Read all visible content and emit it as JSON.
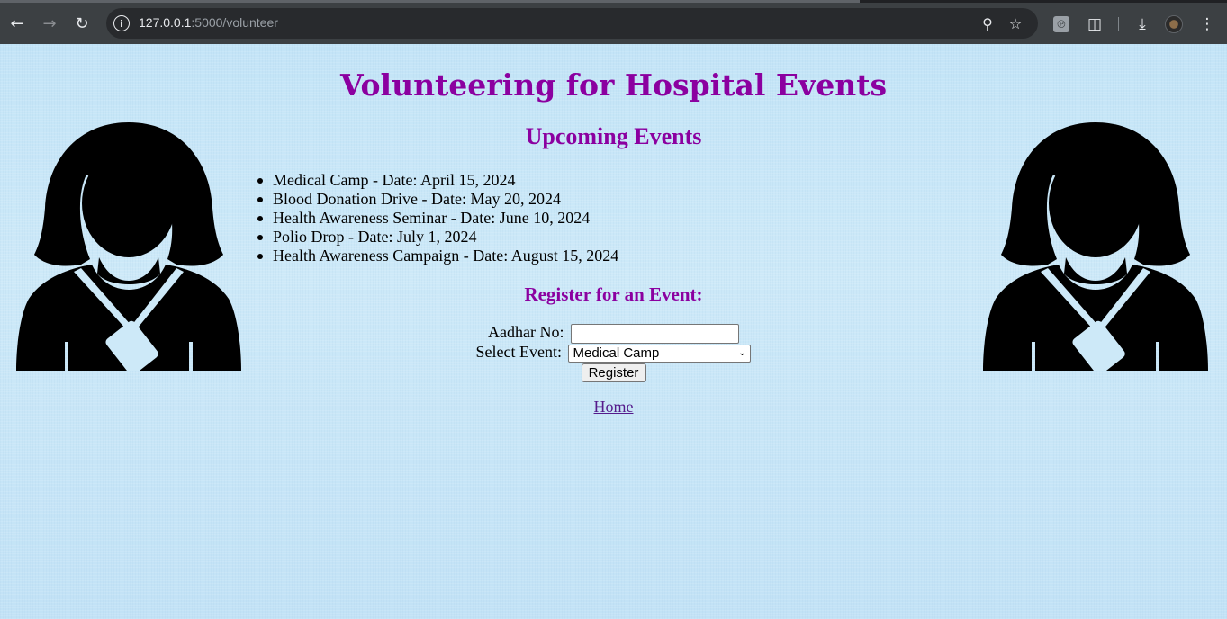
{
  "browser": {
    "url_host": "127.0.0.1",
    "url_path": ":5000/volunteer",
    "icons": [
      "back-arrow-icon",
      "forward-arrow-icon",
      "reload-icon",
      "site-info-icon",
      "zoom-icon",
      "bookmark-star-icon",
      "extension-icon",
      "puzzle-extensions-icon",
      "download-icon",
      "profile-avatar",
      "menu-kebab-icon"
    ]
  },
  "page": {
    "title": "Volunteering for Hospital Events",
    "subtitle": "Upcoming Events",
    "events": [
      "Medical Camp - Date: April 15, 2024",
      "Blood Donation Drive - Date: May 20, 2024",
      "Health Awareness Seminar - Date: June 10, 2024",
      "Polio Drop - Date: July 1, 2024",
      "Health Awareness Campaign - Date: August 15, 2024"
    ],
    "register_heading": "Register for an Event:",
    "aadhar_label": "Aadhar No:",
    "aadhar_value": "",
    "event_label": "Select Event:",
    "event_selected": "Medical Camp",
    "register_button": "Register",
    "home_link": "Home"
  },
  "colors": {
    "heading": "#8b00a0",
    "link": "#551a8b",
    "background": "#c8e6f7"
  }
}
